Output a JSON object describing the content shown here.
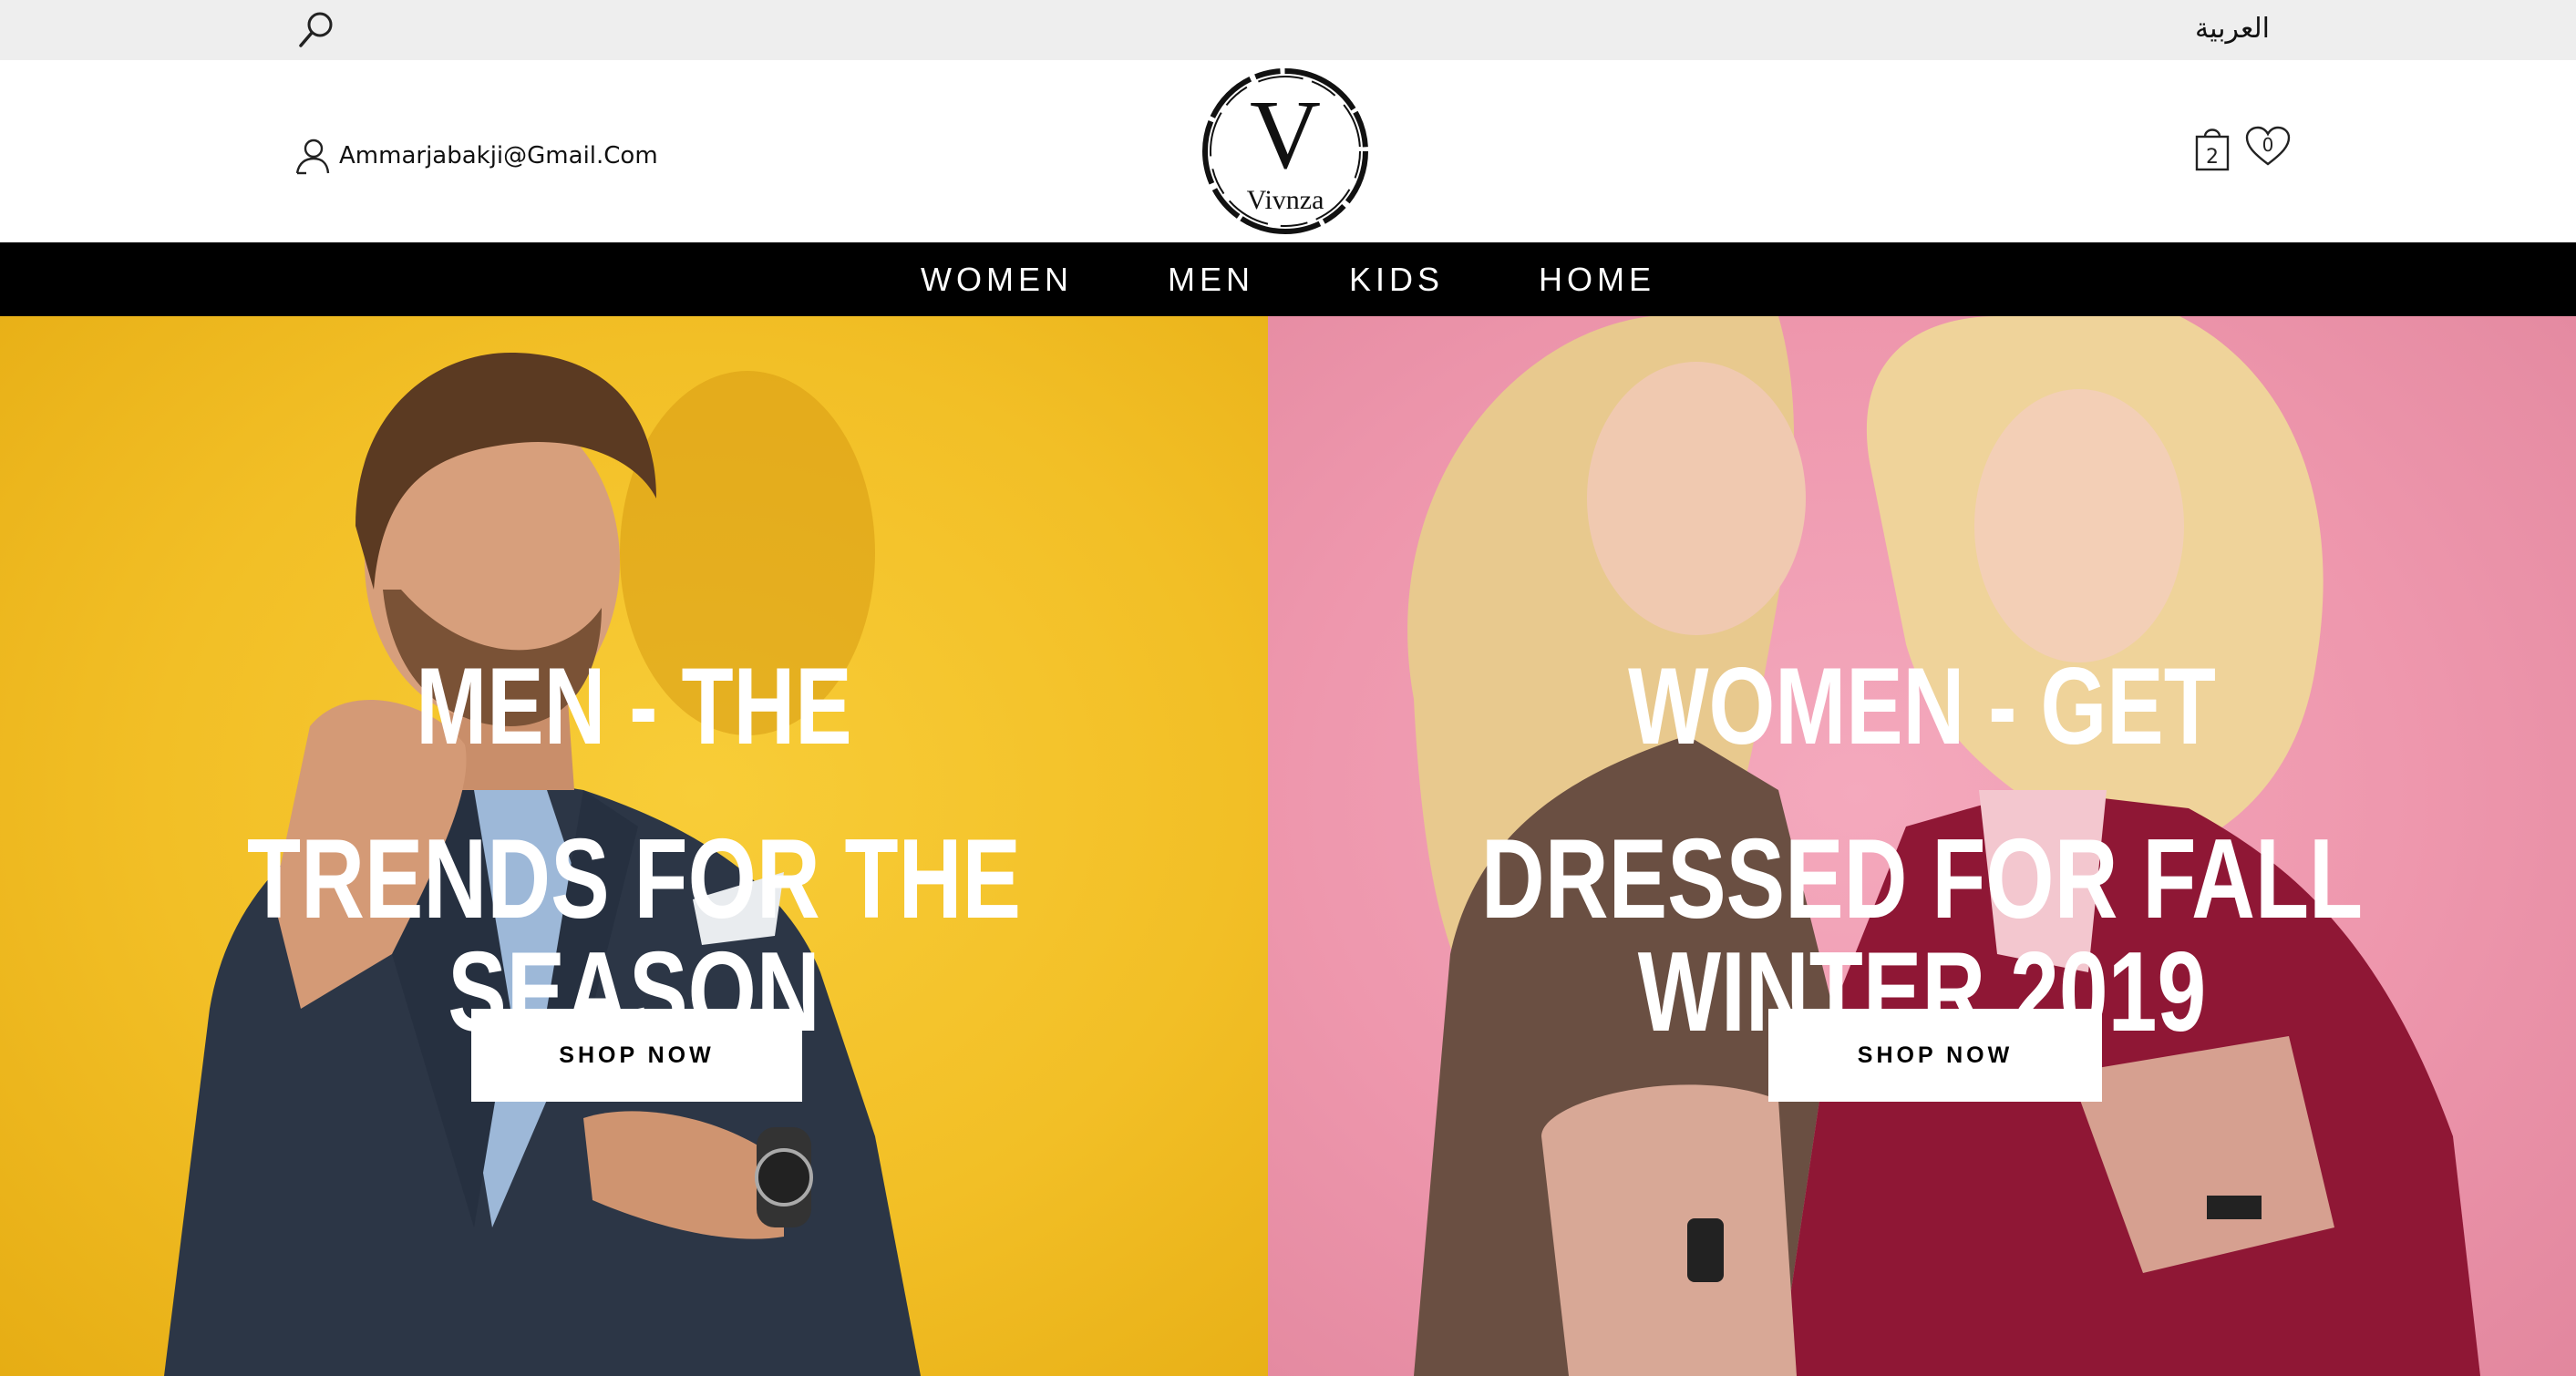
{
  "topbar": {
    "search_icon": "search-icon",
    "language_link": "العربية"
  },
  "header": {
    "account_icon": "user-icon",
    "account_email": "Ammarjabakji@Gmail.Com",
    "logo": {
      "letter": "V",
      "name": "Vivnza"
    },
    "cart": {
      "icon": "shopping-bag-icon",
      "count": "2"
    },
    "wishlist": {
      "icon": "heart-icon",
      "count": "0"
    }
  },
  "nav": {
    "items": [
      "WOMEN",
      "MEN",
      "KIDS",
      "HOME"
    ]
  },
  "hero": {
    "men": {
      "line1": "MEN - THE",
      "line2": "TRENDS FOR THE SEASON",
      "button": "SHOP NOW",
      "background": "#f4c430"
    },
    "women": {
      "line1": "WOMEN - GET",
      "line2": "DRESSED FOR FALL WINTER 2019",
      "button": "SHOP NOW",
      "background": "#ef9ab0"
    }
  },
  "colors": {
    "topbar_bg": "#eeeeee",
    "nav_bg": "#000000",
    "nav_text": "#ffffff"
  }
}
